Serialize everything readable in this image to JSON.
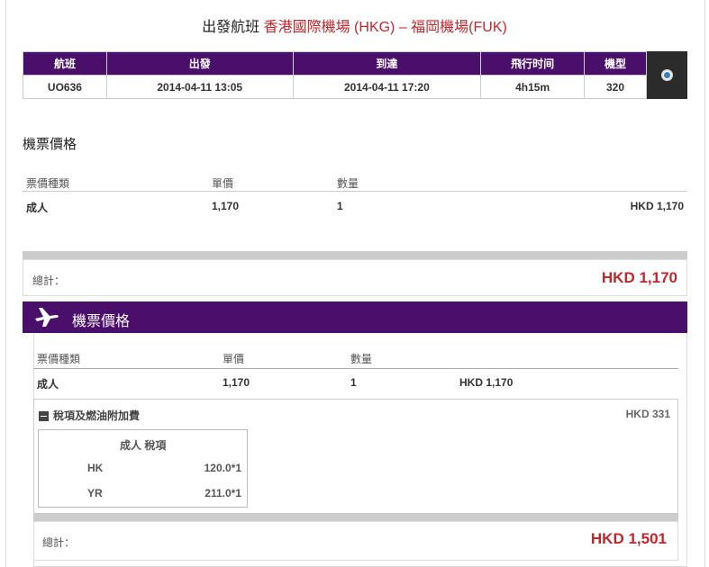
{
  "header": {
    "label": "出發航班",
    "route": "香港國際機場 (HKG) – 福岡機場(FUK)"
  },
  "flight_table": {
    "columns": [
      "航班",
      "出發",
      "到達",
      "飛行时间",
      "機型"
    ],
    "row": [
      "UO636",
      "2014-04-11 13:05",
      "2014-04-11 17:20",
      "4h15m",
      "320"
    ]
  },
  "info_icon": "info-circle-icon",
  "fare_summary": {
    "title": "機票價格",
    "columns": [
      "票價種類",
      "單價",
      "數量"
    ],
    "row": {
      "type": "成人",
      "unit_price": "1,170",
      "qty": "1",
      "amount": "HKD 1,170"
    },
    "total_label": "總計：",
    "total_value": "HKD 1,170"
  },
  "fare_detail": {
    "title": "機票價格",
    "plane_icon": "airplane-icon",
    "columns": [
      "票價種類",
      "單價",
      "數量"
    ],
    "row": {
      "type": "成人",
      "unit_price": "1,170",
      "qty": "1",
      "amount": "HKD 1,170"
    },
    "tax": {
      "title": "稅項及燃油附加費",
      "amount": "HKD 331",
      "box_title": "成人 稅項",
      "items": [
        {
          "code": "HK",
          "value": "120.0*1"
        },
        {
          "code": "YR",
          "value": "211.0*1"
        }
      ]
    },
    "total_label": "總計：",
    "total_value": "HKD 1,501"
  },
  "colors": {
    "brand_purple": "#4a0f6b",
    "price_red": "#c0282d"
  }
}
